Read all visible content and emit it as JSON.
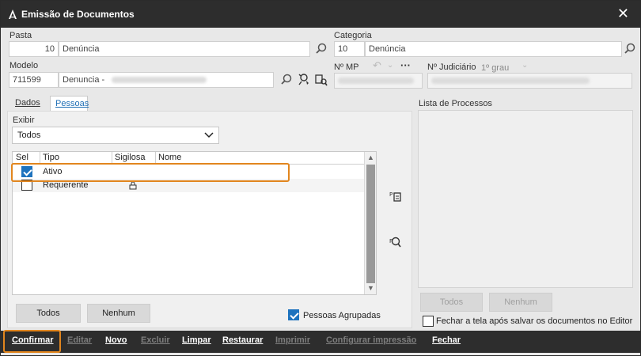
{
  "window": {
    "title": "Emissão de Documentos"
  },
  "fields": {
    "pasta": {
      "label": "Pasta",
      "code": "10",
      "name": "Denúncia"
    },
    "categoria": {
      "label": "Categoria",
      "code": "10",
      "name": "Denúncia"
    },
    "modelo": {
      "label": "Modelo",
      "code": "711599",
      "name": "Denuncia -"
    },
    "nmp": {
      "label": "Nº MP"
    },
    "njudiciario": {
      "label": "Nº Judiciário",
      "value": "1º grau"
    }
  },
  "tabs": {
    "dados": "Dados",
    "pessoas": "Pessoas"
  },
  "exibir": {
    "label": "Exibir",
    "selected": "Todos"
  },
  "grid": {
    "columns": [
      "Sel",
      "Tipo",
      "Sigilosa",
      "Nome"
    ],
    "rows": [
      {
        "tipo": "Ativo",
        "checked": true
      },
      {
        "tipo": "Requerente",
        "checked": false
      }
    ]
  },
  "buttons": {
    "todos": "Todos",
    "nenhum": "Nenhum"
  },
  "pessoas_agrupadas": "Pessoas Agrupadas",
  "processos": {
    "label": "Lista de Processos",
    "todos": "Todos",
    "nenhum": "Nenhum",
    "fechar_label": "Fechar a tela após salvar os documentos no Editor"
  },
  "bottom": {
    "confirmar": "Confirmar",
    "editar": "Editar",
    "novo": "Novo",
    "excluir": "Excluir",
    "limpar": "Limpar",
    "restaurar": "Restaurar",
    "imprimir": "Imprimir",
    "configurar": "Configurar impressão",
    "fechar": "Fechar"
  },
  "colors": {
    "accent": "#1e73be",
    "highlight": "#e2861e",
    "bar": "#2d2d2d"
  }
}
